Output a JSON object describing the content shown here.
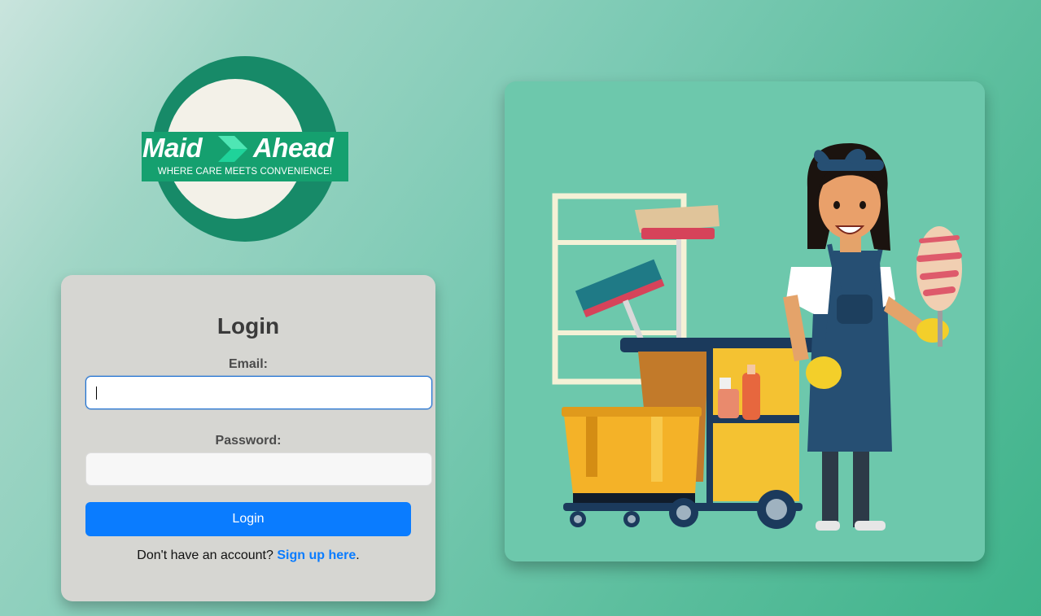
{
  "logo": {
    "word_left": "Maid",
    "word_right": "Ahead",
    "tagline": "WHERE CARE MEETS CONVENIENCE!",
    "colors": {
      "ring": "#178a68",
      "banner": "#15a06f",
      "inner": "#f3f1e8"
    }
  },
  "login": {
    "title": "Login",
    "email_label": "Email:",
    "email_value": "",
    "password_label": "Password:",
    "password_value": "",
    "button_label": "Login",
    "signup_prompt": "Don't have an account?",
    "signup_link": "Sign up here",
    "signup_suffix": "."
  },
  "illustration": {
    "icon": "cleaning-maid-with-cart-illustration"
  },
  "colors": {
    "accent": "#0a7cff",
    "card_bg": "#d6d6d2",
    "illustration_bg": "#6dc8ac"
  }
}
